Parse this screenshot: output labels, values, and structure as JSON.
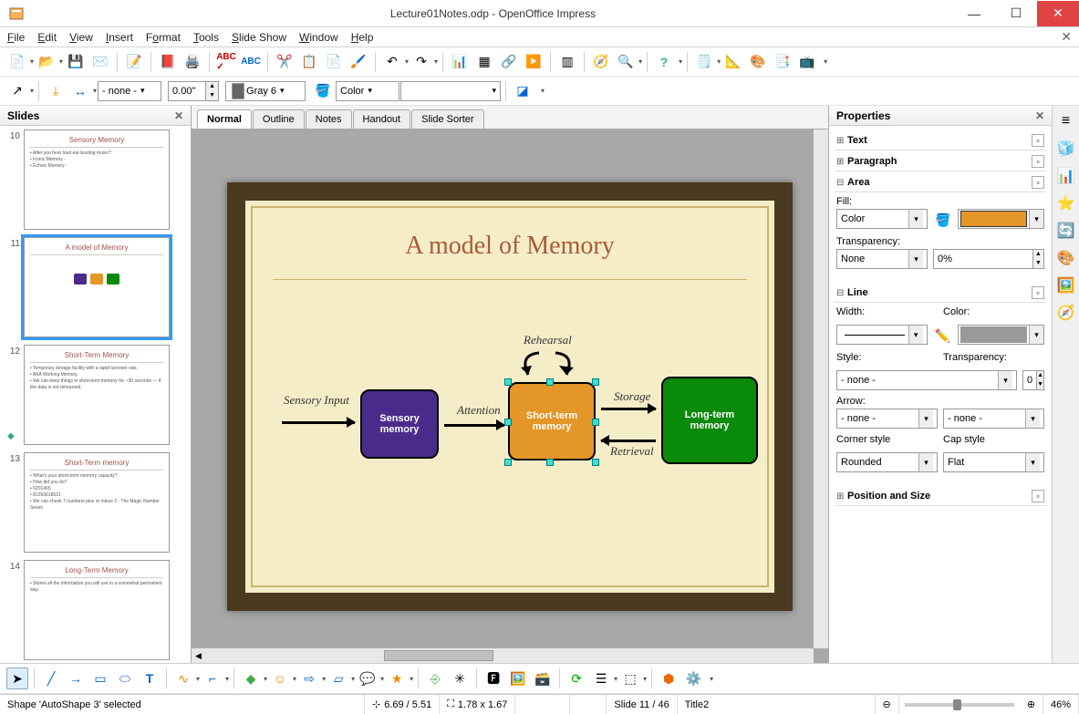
{
  "window": {
    "title": "Lecture01Notes.odp - OpenOffice Impress"
  },
  "menus": [
    "File",
    "Edit",
    "View",
    "Insert",
    "Format",
    "Tools",
    "Slide Show",
    "Window",
    "Help"
  ],
  "toolbar2": {
    "line_style": "- none -",
    "line_width": "0.00\"",
    "line_color_name": "Gray 6",
    "fill_type": "Color"
  },
  "slides_panel": {
    "title": "Slides"
  },
  "slides": [
    {
      "num": "10",
      "title": "Sensory Memory",
      "bullets": [
        "After you hear loud ear-busting music?",
        "Iconic Memory -",
        "Echoic Memory -"
      ]
    },
    {
      "num": "11",
      "title": "A model of Memory",
      "diagram": true
    },
    {
      "num": "12",
      "title": "Short-Term Memory",
      "bullets": [
        "Temporary storage facility with a rapid turnover rate.",
        "AKA Working Memory.",
        "We can keep things in short-term memory for ~30 seconds — if the data is not rehearsed."
      ]
    },
    {
      "num": "13",
      "title": "Short-Term memory",
      "bullets": [
        "What's your short-term memory capacity?",
        "How did you do?",
        "  6201465",
        "  81293618521",
        "We can chunk 7 numbers plus or minus 2 - The Magic Number Seven"
      ]
    },
    {
      "num": "14",
      "title": "Long-Term Memory",
      "bullets": [
        "Stores all the information you will use in a somewhat permanent way."
      ]
    }
  ],
  "view_tabs": [
    "Normal",
    "Outline",
    "Notes",
    "Handout",
    "Slide Sorter"
  ],
  "slide": {
    "title": "A model of Memory",
    "labels": {
      "sensory_input": "Sensory Input",
      "attention": "Attention",
      "rehearsal": "Rehearsal",
      "storage": "Storage",
      "retrieval": "Retrieval"
    },
    "boxes": {
      "sensory": "Sensory\nmemory",
      "stm": "Short-term\nmemory",
      "ltm": "Long-term\nmemory"
    }
  },
  "properties": {
    "title": "Properties",
    "sections": {
      "text": "Text",
      "paragraph": "Paragraph",
      "area": "Area",
      "line": "Line",
      "pos": "Position and Size"
    },
    "area": {
      "fill_label": "Fill:",
      "fill_type": "Color",
      "transparency_label": "Transparency:",
      "transparency_type": "None",
      "transparency_value": "0%"
    },
    "line": {
      "width_label": "Width:",
      "color_label": "Color:",
      "style_label": "Style:",
      "style_value": "- none -",
      "transparency_label": "Transparency:",
      "transparency_value": "0%",
      "arrow_label": "Arrow:",
      "arrow_start": "- none -",
      "arrow_end": "- none -",
      "corner_label": "Corner style",
      "corner_value": "Rounded",
      "cap_label": "Cap style",
      "cap_value": "Flat"
    }
  },
  "status": {
    "selection": "Shape 'AutoShape 3' selected",
    "pos": "6.69 / 5.51",
    "size": "1.78 x 1.67",
    "slide_info": "Slide 11 / 46",
    "layout": "Title2",
    "zoom": "46%"
  }
}
